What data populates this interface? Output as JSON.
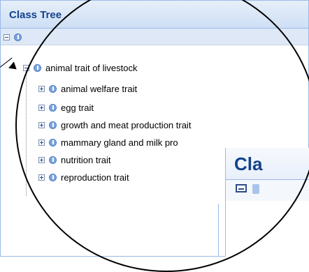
{
  "panel": {
    "title": "Class Tree"
  },
  "overlay": {
    "title": "Cla"
  },
  "tree": {
    "root": "animal trait of livestock",
    "children": [
      "animal welfare trait",
      "egg trait",
      "growth and meat production trait",
      "mammary gland and milk pro",
      "nutrition trait",
      "reproduction trait"
    ]
  }
}
